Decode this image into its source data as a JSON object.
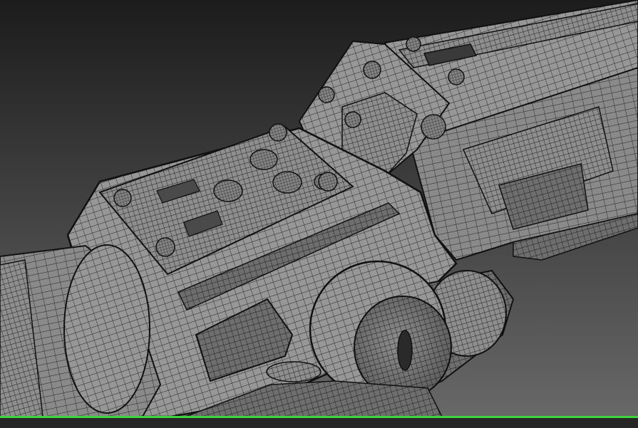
{
  "viewport": {
    "render_mode": "wireframe-on-shaded",
    "background_top": "#1c1c1c",
    "background_bottom": "#6a6a6a",
    "surface_color": "#8c8c8c",
    "wire_color": "#1e1e1e",
    "active_indicator_color": "#3ed23e"
  },
  "scene": {
    "subject": "mechanical-scope-model",
    "bolt_count": 12,
    "knob_count": 2,
    "button_count": 4
  }
}
